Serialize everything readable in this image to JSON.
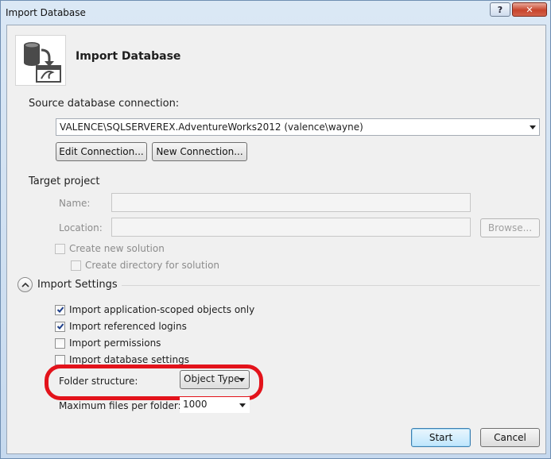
{
  "window": {
    "title": "Import Database",
    "help_label": "?",
    "close_label": "✕"
  },
  "header": {
    "title": "Import Database",
    "icon": "database-import-icon"
  },
  "source": {
    "label": "Source database connection:",
    "connection": "VALENCE\\SQLSERVEREX.AdventureWorks2012 (valence\\wayne)",
    "edit_button": "Edit Connection...",
    "new_button": "New Connection..."
  },
  "target": {
    "label": "Target project",
    "name_label": "Name:",
    "location_label": "Location:",
    "browse_button": "Browse...",
    "create_solution": "Create new solution",
    "create_directory": "Create directory for solution"
  },
  "settings": {
    "label": "Import Settings",
    "options": [
      {
        "label": "Import application-scoped objects only",
        "checked": true
      },
      {
        "label": "Import referenced logins",
        "checked": true
      },
      {
        "label": "Import permissions",
        "checked": false
      },
      {
        "label": "Import database settings",
        "checked": false
      }
    ],
    "folder_label": "Folder structure:",
    "folder_value": "Object Type",
    "max_files_label": "Maximum files per folder:",
    "max_files_value": "1000"
  },
  "footer": {
    "start": "Start",
    "cancel": "Cancel"
  },
  "colors": {
    "highlight": "#e3131b",
    "default_button": "#3c7fb1"
  }
}
